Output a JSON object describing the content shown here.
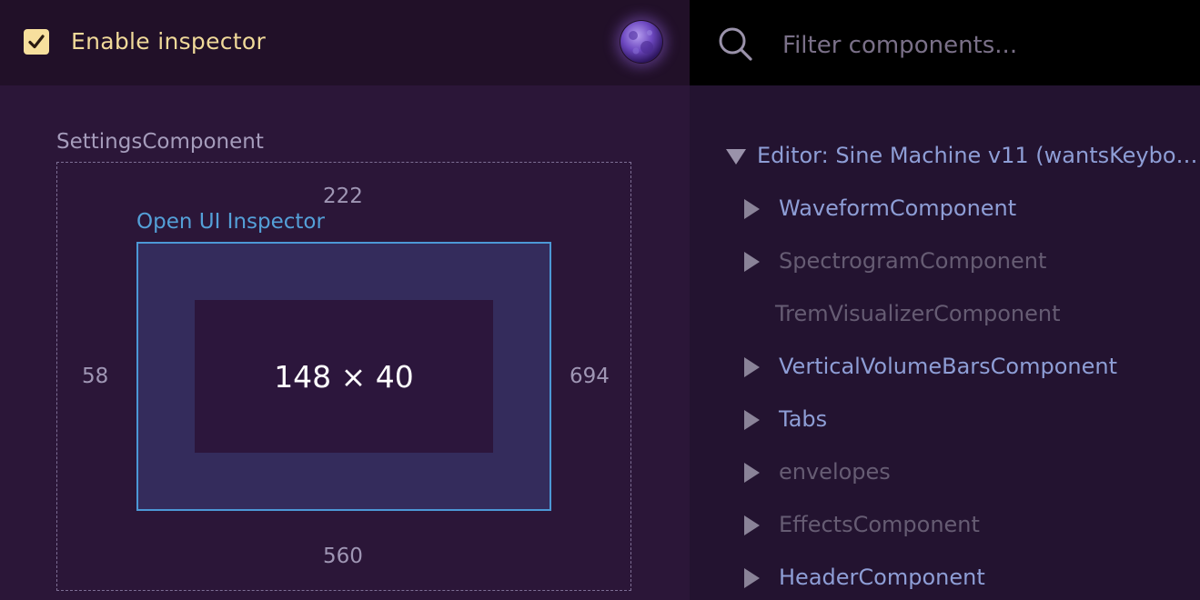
{
  "header": {
    "enable_inspector_label": "Enable inspector",
    "enable_inspector_checked": true
  },
  "inspector": {
    "component_name": "SettingsComponent",
    "top_value": "222",
    "left_value": "58",
    "right_value": "694",
    "bottom_value": "560",
    "selected_label": "Open UI Inspector",
    "size_text": "148 × 40"
  },
  "search": {
    "placeholder": "Filter components..."
  },
  "tree": {
    "root": {
      "label": "Editor: Sine Machine v11 (wantsKeybo…",
      "expanded": true
    },
    "items": [
      {
        "label": "WaveformComponent",
        "has_children": true,
        "visible": true
      },
      {
        "label": "SpectrogramComponent",
        "has_children": true,
        "visible": false
      },
      {
        "label": "TremVisualizerComponent",
        "has_children": false,
        "visible": false
      },
      {
        "label": "VerticalVolumeBarsComponent",
        "has_children": true,
        "visible": true
      },
      {
        "label": "Tabs",
        "has_children": true,
        "visible": true
      },
      {
        "label": "envelopes",
        "has_children": true,
        "visible": false
      },
      {
        "label": "EffectsComponent",
        "has_children": true,
        "visible": false
      },
      {
        "label": "HeaderComponent",
        "has_children": true,
        "visible": true
      }
    ]
  },
  "colors": {
    "accent_blue": "#4c98d6",
    "checkbox_yellow": "#f7df9d",
    "panel_bg": "#2b1638"
  }
}
